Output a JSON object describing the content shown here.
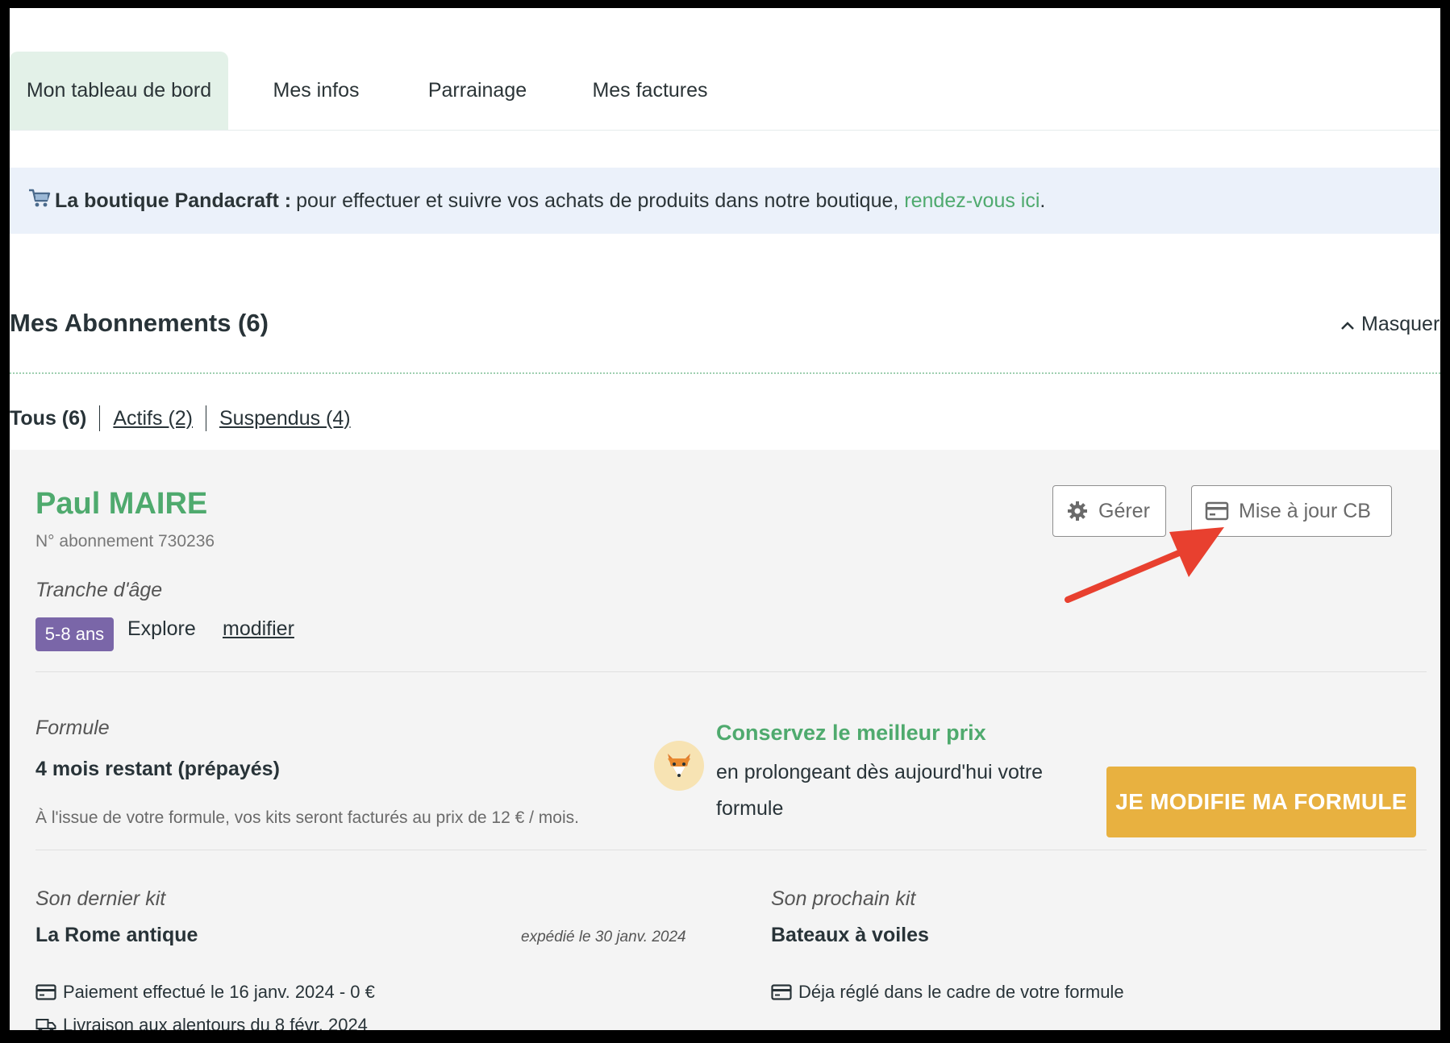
{
  "tabs": [
    {
      "label": "Mon tableau de bord",
      "active": true
    },
    {
      "label": "Mes infos",
      "active": false
    },
    {
      "label": "Parrainage",
      "active": false
    },
    {
      "label": "Mes factures",
      "active": false
    }
  ],
  "shop_banner": {
    "icon": "cart-icon",
    "bold": "La boutique Pandacraft :",
    "text": "pour effectuer et suivre vos achats de produits dans notre boutique,",
    "link": "rendez-vous ici",
    "end": "."
  },
  "subscriptions": {
    "title": "Mes Abonnements (6)",
    "hide_label": "Masquer",
    "filters": {
      "all": "Tous (6)",
      "active": "Actifs (2)",
      "suspended": "Suspendus (4)"
    }
  },
  "card": {
    "name": "Paul MAIRE",
    "number": "N° abonnement 730236",
    "manage_label": "Gérer",
    "update_card_label": "Mise à jour CB",
    "age_label": "Tranche d'âge",
    "age_badge": "5-8 ans",
    "age_name": "Explore",
    "age_modify": "modifier",
    "formula_label": "Formule",
    "formula_remaining": "4 mois restant (prépayés)",
    "formula_note": "À l'issue de votre formule, vos kits seront facturés au prix de 12 € / mois.",
    "promo_title": "Conservez le meilleur prix",
    "promo_text": "en prolongeant dès aujourd'hui votre formule",
    "promo_button": "JE MODIFIE MA FORMULE",
    "last_kit_label": "Son dernier kit",
    "last_kit_name": "La Rome antique",
    "last_kit_shipped": "expédié le 30 janv. 2024",
    "last_kit_payment": "Paiement effectué le 16 janv. 2024 - 0 €",
    "last_kit_delivery": "Livraison aux alentours du 8 févr. 2024",
    "next_kit_label": "Son prochain kit",
    "next_kit_name": "Bateaux à voiles",
    "next_kit_payment": "Déja réglé dans le cadre de votre formule"
  },
  "colors": {
    "accent_green": "#4faa6e",
    "tab_active_bg": "#e3f1e8",
    "banner_bg": "#ebf1fa",
    "badge_purple": "#7a66a8",
    "cta_yellow": "#e8b140",
    "annotation_red": "#e8402f"
  }
}
